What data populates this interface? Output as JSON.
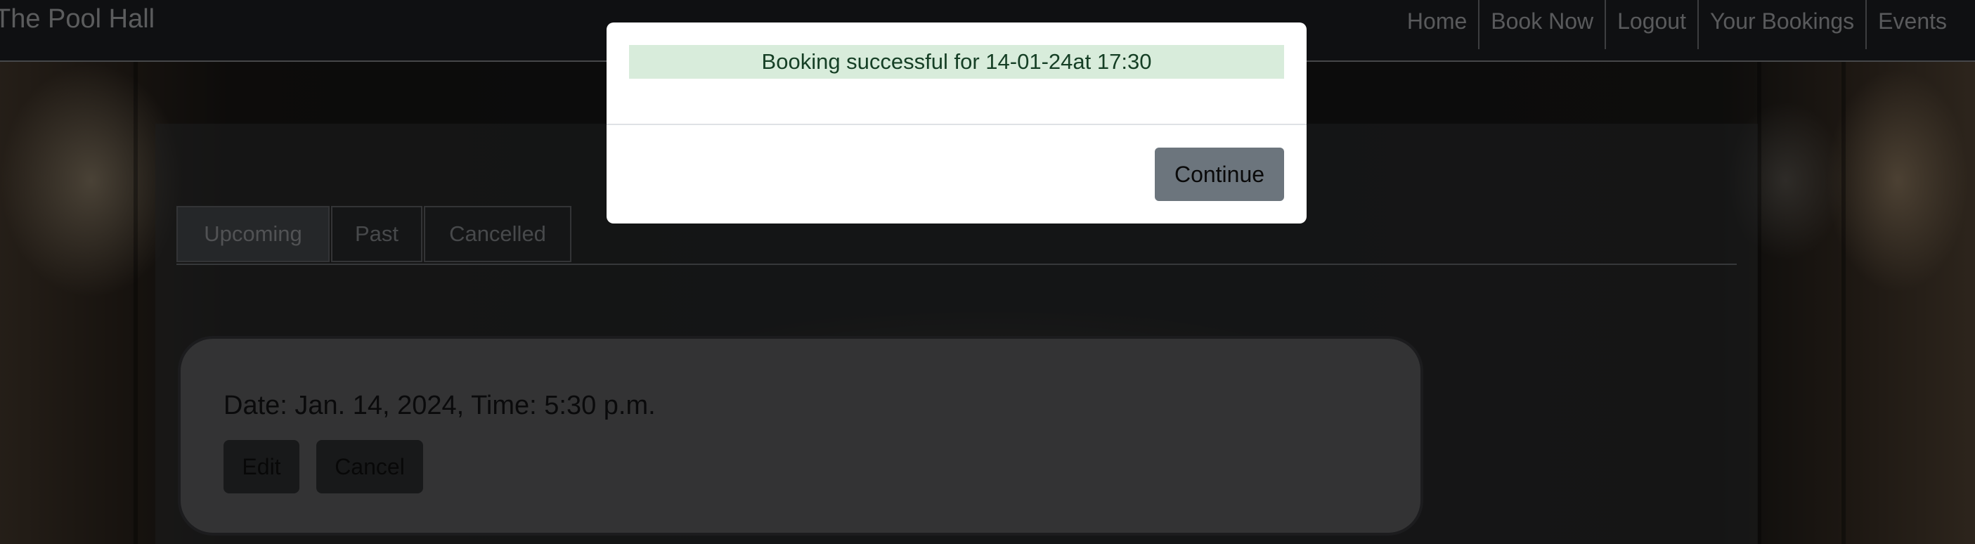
{
  "navbar": {
    "brand": "The Pool Hall",
    "links": [
      "Home",
      "Book Now",
      "Logout",
      "Your Bookings",
      "Events"
    ]
  },
  "tabs": [
    "Upcoming",
    "Past",
    "Cancelled"
  ],
  "booking": {
    "text": "Date: Jan. 14, 2024, Time: 5:30 p.m.",
    "edit_label": "Edit",
    "cancel_label": "Cancel"
  },
  "modal": {
    "message": "Booking successful for 14-01-24at 17:30",
    "continue_label": "Continue"
  }
}
